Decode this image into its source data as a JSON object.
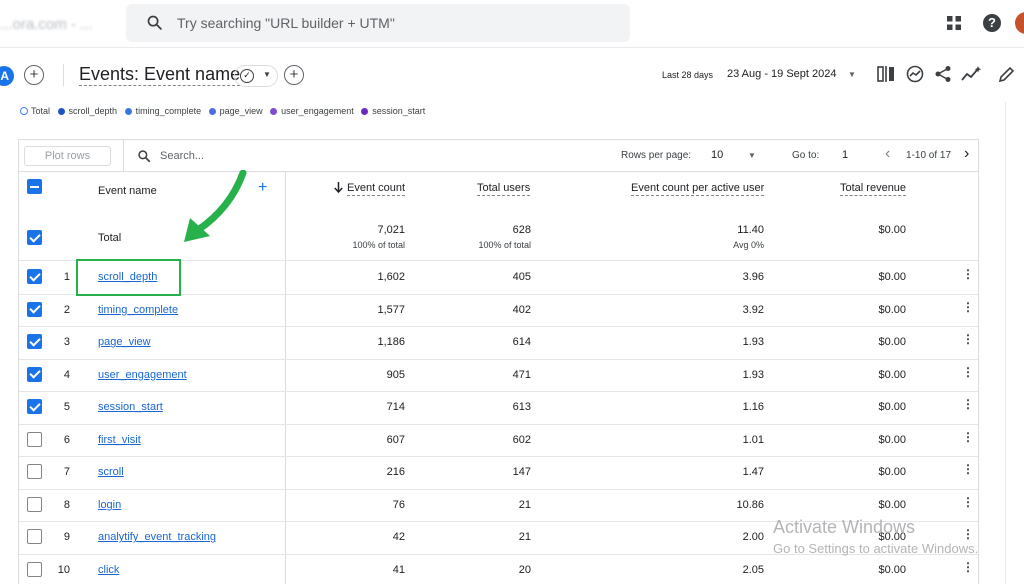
{
  "topbar": {
    "brand": "...ora.com - ...",
    "search_placeholder": "Try searching \"URL builder + UTM\"",
    "icons": [
      "search-icon",
      "apps-grid-icon",
      "help-icon",
      "account-avatar"
    ]
  },
  "report": {
    "badge": "A",
    "title": "Events: Event name",
    "date_label": "Last 28 days",
    "date_range": "23 Aug - 19 Sept 2024",
    "tool_icons": [
      "compare-icon",
      "insights-icon",
      "share-icon",
      "explore-icon",
      "edit-icon"
    ]
  },
  "legend": [
    "Total",
    "scroll_depth",
    "timing_complete",
    "page_view",
    "user_engagement",
    "session_start"
  ],
  "legend_colors": [
    "#4285f4",
    "#1a56c4",
    "#3a78e0",
    "#4e6ce8",
    "#7e4cd4",
    "#6a2bb8"
  ],
  "table": {
    "plot_rows_label": "Plot rows",
    "search_placeholder": "Search...",
    "rows_per_page_label": "Rows per page:",
    "rows_per_page": "10",
    "goto_label": "Go to:",
    "goto_value": "1",
    "page_label": "1-10 of 17",
    "col_event_name": "Event name",
    "col_event_count": "Event count",
    "col_total_users": "Total users",
    "col_per_user": "Event count per active user",
    "col_revenue": "Total revenue",
    "total": {
      "label": "Total",
      "event_count": "7,021",
      "event_count_sub": "100% of total",
      "total_users": "628",
      "total_users_sub": "100% of total",
      "per_user": "11.40",
      "per_user_sub": "Avg 0%",
      "revenue": "$0.00"
    },
    "rows": [
      {
        "n": "1",
        "name": "scroll_depth",
        "count": "1,602",
        "users": "405",
        "per_user": "3.96",
        "revenue": "$0.00",
        "checked": true
      },
      {
        "n": "2",
        "name": "timing_complete",
        "count": "1,577",
        "users": "402",
        "per_user": "3.92",
        "revenue": "$0.00",
        "checked": true
      },
      {
        "n": "3",
        "name": "page_view",
        "count": "1,186",
        "users": "614",
        "per_user": "1.93",
        "revenue": "$0.00",
        "checked": true
      },
      {
        "n": "4",
        "name": "user_engagement",
        "count": "905",
        "users": "471",
        "per_user": "1.93",
        "revenue": "$0.00",
        "checked": true
      },
      {
        "n": "5",
        "name": "session_start",
        "count": "714",
        "users": "613",
        "per_user": "1.16",
        "revenue": "$0.00",
        "checked": true
      },
      {
        "n": "6",
        "name": "first_visit",
        "count": "607",
        "users": "602",
        "per_user": "1.01",
        "revenue": "$0.00",
        "checked": false
      },
      {
        "n": "7",
        "name": "scroll",
        "count": "216",
        "users": "147",
        "per_user": "1.47",
        "revenue": "$0.00",
        "checked": false
      },
      {
        "n": "8",
        "name": "login",
        "count": "76",
        "users": "21",
        "per_user": "10.86",
        "revenue": "$0.00",
        "checked": false
      },
      {
        "n": "9",
        "name": "analytify_event_tracking",
        "count": "42",
        "users": "21",
        "per_user": "2.00",
        "revenue": "$0.00",
        "checked": false
      },
      {
        "n": "10",
        "name": "click",
        "count": "41",
        "users": "20",
        "per_user": "2.05",
        "revenue": "$0.00",
        "checked": false
      }
    ]
  },
  "annotation": {
    "highlight_color": "#27b14a"
  },
  "watermark": {
    "line1": "Activate Windows",
    "line2": "Go to Settings to activate Windows."
  }
}
